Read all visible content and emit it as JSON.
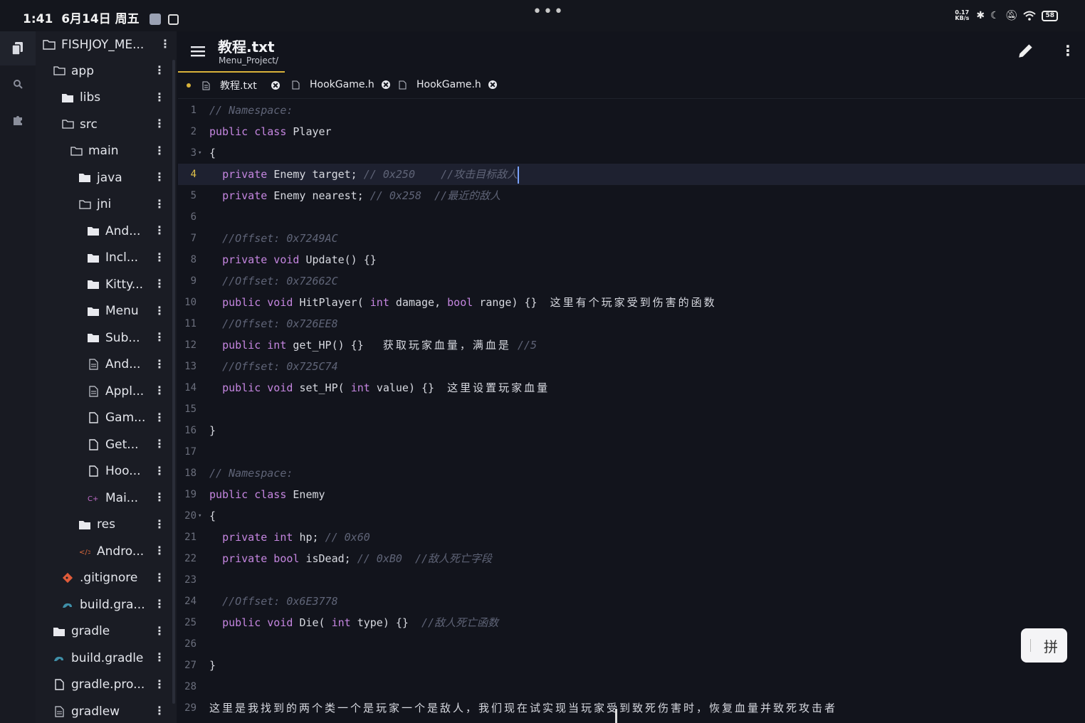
{
  "status_bar": {
    "time": "1:41",
    "date": "6月14日 周五",
    "more": "•••",
    "net_speed_value": "0.17",
    "net_speed_unit": "KB/s",
    "battery": "58"
  },
  "activity_bar": {
    "items": [
      {
        "icon": "files-icon"
      },
      {
        "icon": "search-icon"
      },
      {
        "icon": "extensions-icon"
      }
    ]
  },
  "file_tree": {
    "root": "FISHJOY_ME...",
    "items": [
      {
        "label": "app",
        "icon": "folder-open-icon",
        "depth": 1
      },
      {
        "label": "libs",
        "icon": "folder-icon",
        "depth": 2
      },
      {
        "label": "src",
        "icon": "folder-open-icon",
        "depth": 2
      },
      {
        "label": "main",
        "icon": "folder-open-icon",
        "depth": 3
      },
      {
        "label": "java",
        "icon": "folder-icon",
        "depth": 4
      },
      {
        "label": "jni",
        "icon": "folder-open-icon",
        "depth": 4
      },
      {
        "label": "And...",
        "icon": "folder-icon",
        "depth": 5
      },
      {
        "label": "Incl...",
        "icon": "folder-icon",
        "depth": 5
      },
      {
        "label": "Kitty...",
        "icon": "folder-icon",
        "depth": 5
      },
      {
        "label": "Menu",
        "icon": "folder-icon",
        "depth": 5
      },
      {
        "label": "Sub...",
        "icon": "folder-icon",
        "depth": 5
      },
      {
        "label": "And...",
        "icon": "text-file-icon",
        "depth": 5
      },
      {
        "label": "Appl...",
        "icon": "text-file-icon",
        "depth": 5
      },
      {
        "label": "Gam...",
        "icon": "file-icon",
        "depth": 5
      },
      {
        "label": "Get...",
        "icon": "file-icon",
        "depth": 5
      },
      {
        "label": "Hoo...",
        "icon": "file-icon",
        "depth": 5
      },
      {
        "label": "Mai...",
        "icon": "cpp-file-icon",
        "depth": 5
      },
      {
        "label": "res",
        "icon": "folder-icon",
        "depth": 4
      },
      {
        "label": "Andro...",
        "icon": "xml-file-icon",
        "depth": 4
      },
      {
        "label": ".gitignore",
        "icon": "git-icon",
        "depth": 2
      },
      {
        "label": "build.gra...",
        "icon": "gradle-icon",
        "depth": 2
      },
      {
        "label": "gradle",
        "icon": "folder-icon",
        "depth": 1
      },
      {
        "label": "build.gradle",
        "icon": "gradle-icon",
        "depth": 1
      },
      {
        "label": "gradle.pro...",
        "icon": "file-icon",
        "depth": 1
      },
      {
        "label": "gradlew",
        "icon": "text-file-icon",
        "depth": 1
      }
    ]
  },
  "editor": {
    "title": "教程.txt",
    "path": "Menu_Project/",
    "tabs": [
      {
        "label": "教程.txt",
        "modified": true,
        "active": true
      },
      {
        "label": "HookGame.h",
        "modified": false,
        "active": false
      },
      {
        "label": "HookGame.h",
        "modified": false,
        "active": false
      }
    ],
    "current_line": 4,
    "lines": [
      {
        "n": "1",
        "fold": false,
        "segs": [
          [
            "cm",
            "// Namespace:"
          ]
        ]
      },
      {
        "n": "2",
        "fold": false,
        "segs": [
          [
            "kw",
            "public class"
          ],
          [
            "",
            "Player"
          ]
        ]
      },
      {
        "n": "3",
        "fold": true,
        "segs": [
          [
            "",
            "{"
          ]
        ]
      },
      {
        "n": "4",
        "fold": false,
        "segs": [
          [
            "",
            "  "
          ],
          [
            "kw",
            "private"
          ],
          [
            "",
            "Enemy target;"
          ],
          [
            "cm",
            "// 0x250    //攻击目标敌人"
          ]
        ]
      },
      {
        "n": "5",
        "fold": false,
        "segs": [
          [
            "",
            "  "
          ],
          [
            "kw",
            "private"
          ],
          [
            "",
            "Enemy nearest;"
          ],
          [
            "cm",
            "// 0x258  //最近的敌人"
          ]
        ]
      },
      {
        "n": "6",
        "fold": false,
        "segs": []
      },
      {
        "n": "7",
        "fold": false,
        "segs": [
          [
            "",
            "  "
          ],
          [
            "cm",
            "//Offset: 0x7249AC"
          ]
        ]
      },
      {
        "n": "8",
        "fold": false,
        "segs": [
          [
            "",
            "  "
          ],
          [
            "kw",
            "private void"
          ],
          [
            "",
            "Update() {}"
          ]
        ]
      },
      {
        "n": "9",
        "fold": false,
        "segs": [
          [
            "",
            "  "
          ],
          [
            "cm",
            "//Offset: 0x72662C"
          ]
        ]
      },
      {
        "n": "10",
        "fold": false,
        "segs": [
          [
            "",
            "  "
          ],
          [
            "kw",
            "public void"
          ],
          [
            "",
            "HitPlayer("
          ],
          [
            "kw",
            "int"
          ],
          [
            "",
            "damage,"
          ],
          [
            "kw",
            "bool"
          ],
          [
            "",
            "range) {}  "
          ],
          [
            "zh",
            "这里有个玩家受到伤害的函数"
          ]
        ]
      },
      {
        "n": "11",
        "fold": false,
        "segs": [
          [
            "",
            "  "
          ],
          [
            "cm",
            "//Offset: 0x726EE8"
          ]
        ]
      },
      {
        "n": "12",
        "fold": false,
        "segs": [
          [
            "",
            "  "
          ],
          [
            "kw",
            "public int"
          ],
          [
            "",
            "get_HP() {}   "
          ],
          [
            "zh",
            "获取玩家血量，满血是"
          ],
          [
            "cm",
            "//5"
          ]
        ]
      },
      {
        "n": "13",
        "fold": false,
        "segs": [
          [
            "",
            "  "
          ],
          [
            "cm",
            "//Offset: 0x725C74"
          ]
        ]
      },
      {
        "n": "14",
        "fold": false,
        "segs": [
          [
            "",
            "  "
          ],
          [
            "kw",
            "public void"
          ],
          [
            "",
            "set_HP("
          ],
          [
            "kw",
            "int"
          ],
          [
            "",
            "value) {}  "
          ],
          [
            "zh",
            "这里设置玩家血量"
          ]
        ]
      },
      {
        "n": "15",
        "fold": false,
        "segs": []
      },
      {
        "n": "16",
        "fold": false,
        "segs": [
          [
            "",
            "}"
          ]
        ]
      },
      {
        "n": "17",
        "fold": false,
        "segs": []
      },
      {
        "n": "18",
        "fold": false,
        "segs": [
          [
            "cm",
            "// Namespace:"
          ]
        ]
      },
      {
        "n": "19",
        "fold": false,
        "segs": [
          [
            "kw",
            "public class"
          ],
          [
            "",
            "Enemy"
          ]
        ]
      },
      {
        "n": "20",
        "fold": true,
        "segs": [
          [
            "",
            "{"
          ]
        ]
      },
      {
        "n": "21",
        "fold": false,
        "segs": [
          [
            "",
            "  "
          ],
          [
            "kw",
            "private int"
          ],
          [
            "",
            "hp;"
          ],
          [
            "cm",
            "// 0x60"
          ]
        ]
      },
      {
        "n": "22",
        "fold": false,
        "segs": [
          [
            "",
            "  "
          ],
          [
            "kw",
            "private bool"
          ],
          [
            "",
            "isDead;"
          ],
          [
            "cm",
            "// 0xB0  //敌人死亡字段"
          ]
        ]
      },
      {
        "n": "23",
        "fold": false,
        "segs": []
      },
      {
        "n": "24",
        "fold": false,
        "segs": [
          [
            "",
            "  "
          ],
          [
            "cm",
            "//Offset: 0x6E3778"
          ]
        ]
      },
      {
        "n": "25",
        "fold": false,
        "segs": [
          [
            "",
            "  "
          ],
          [
            "kw",
            "public void"
          ],
          [
            "",
            "Die("
          ],
          [
            "kw",
            "int"
          ],
          [
            "",
            "type) {}  "
          ],
          [
            "cm",
            "//敌人死亡函数"
          ]
        ]
      },
      {
        "n": "26",
        "fold": false,
        "segs": []
      },
      {
        "n": "27",
        "fold": false,
        "segs": [
          [
            "",
            "}"
          ]
        ]
      },
      {
        "n": "28",
        "fold": false,
        "segs": []
      },
      {
        "n": "29",
        "fold": false,
        "segs": [
          [
            "zh",
            "这里是我找到的两个类一个是玩家一个是敌人，我们现在试实现当玩家受到致死伤害时，恢复血量并致死攻击者"
          ]
        ]
      }
    ]
  },
  "ime": {
    "label": "拼"
  }
}
